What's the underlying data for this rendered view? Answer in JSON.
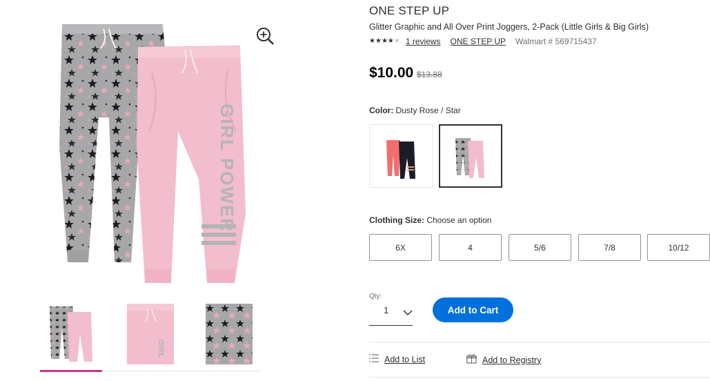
{
  "product": {
    "brand": "ONE STEP UP",
    "title": "Glitter Graphic and All Over Print Joggers, 2-Pack (Little Girls & Big Girls)",
    "rating": 4,
    "rating_max": 5,
    "reviews_link": "1 reviews",
    "brand_link": "ONE STEP UP",
    "walmart_number": "Walmart # 569715437",
    "price": "$10.00",
    "was_price": "$13.88"
  },
  "gallery": {
    "zoom_icon": "zoom-in-icon",
    "main_print_text": "GIRL POWER",
    "thumb_print_text": "GIRL"
  },
  "color": {
    "label": "Color:",
    "value": "Dusty Rose / Star"
  },
  "size": {
    "label": "Clothing Size:",
    "value": "Choose an option",
    "options": [
      "6X",
      "4",
      "5/6",
      "7/8",
      "10/12"
    ]
  },
  "quantity": {
    "label": "Qty:",
    "value": "1"
  },
  "actions": {
    "add_to_cart": "Add to Cart",
    "add_to_list": "Add to List",
    "add_to_registry": "Add to Registry"
  },
  "colors": {
    "accent_blue": "#0071dc",
    "thumb_selected": "#c8338e",
    "pink_pant": "#f2bdcc",
    "gray_pant": "#a7a7a9"
  }
}
